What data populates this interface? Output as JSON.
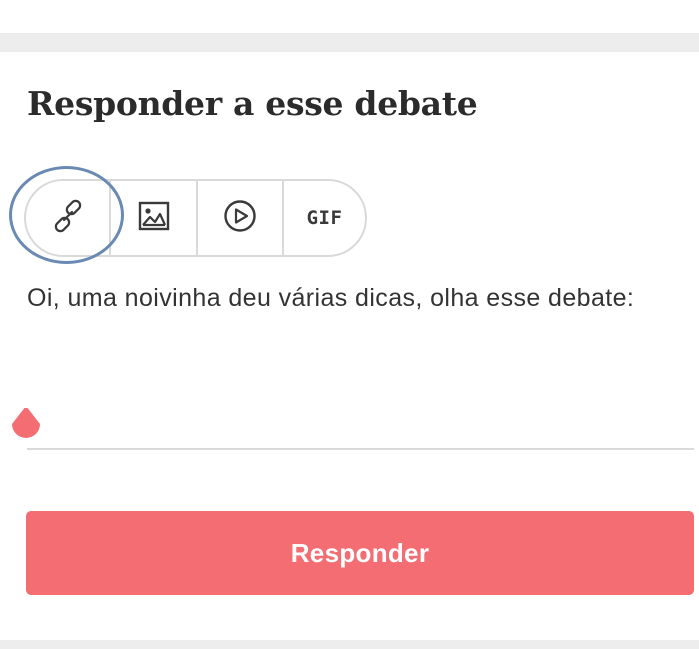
{
  "reply_form": {
    "heading": "Responder a esse debate",
    "toolbar": {
      "items": [
        {
          "name": "link",
          "icon": "link-icon"
        },
        {
          "name": "image",
          "icon": "image-icon"
        },
        {
          "name": "video",
          "icon": "play-circle-icon"
        },
        {
          "name": "gif",
          "icon": "gif-icon",
          "label": "GIF"
        }
      ]
    },
    "reply_text": "Oi, uma noivinha deu várias dicas, olha esse debate:",
    "submit_label": "Responder"
  },
  "colors": {
    "accent": "#f36d72",
    "highlight_ring": "#6a8ab3",
    "heading_text": "#2b2b2b",
    "body_text": "#333333",
    "divider": "#d9d9d9",
    "page_strip": "#ededed"
  }
}
